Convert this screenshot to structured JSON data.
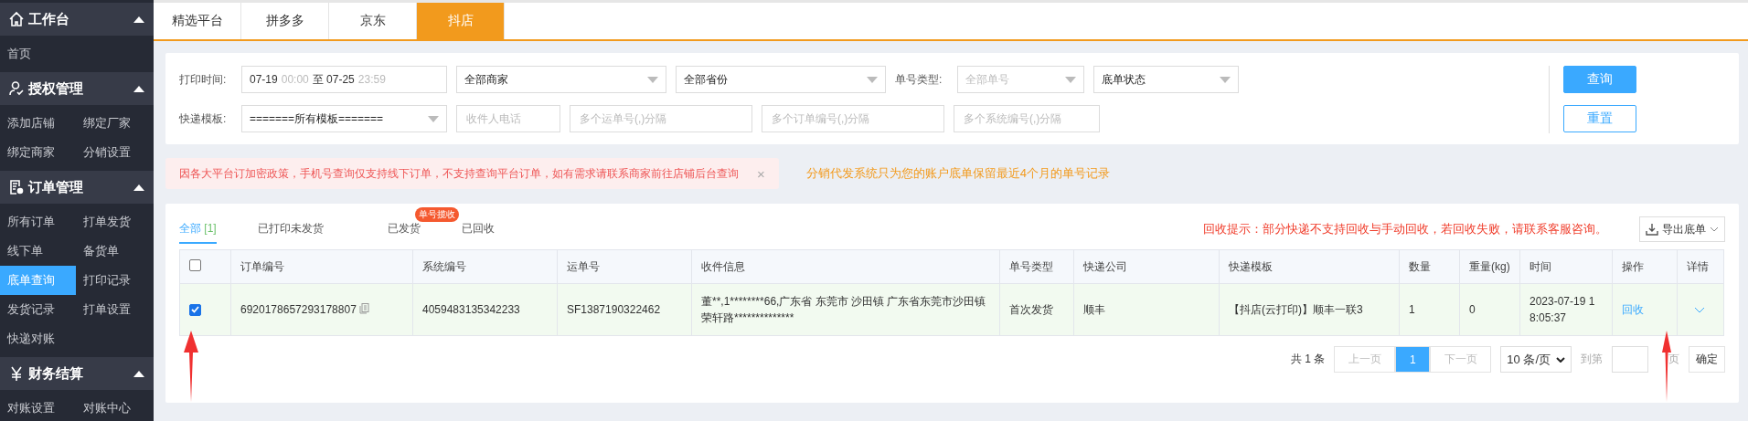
{
  "sidebar": {
    "sections": [
      {
        "title": "工作台",
        "kind": "home",
        "expanded": true,
        "items": [
          {
            "label": "首页",
            "selected": false
          }
        ]
      },
      {
        "title": "授权管理",
        "kind": "user",
        "expanded": true,
        "items": [
          {
            "label": "添加店铺",
            "selected": false
          },
          {
            "label": "绑定厂家",
            "selected": false
          },
          {
            "label": "绑定商家",
            "selected": false
          },
          {
            "label": "分销设置",
            "selected": false
          }
        ]
      },
      {
        "title": "订单管理",
        "kind": "orders",
        "expanded": true,
        "items": [
          {
            "label": "所有订单",
            "selected": false
          },
          {
            "label": "打单发货",
            "selected": false
          },
          {
            "label": "线下单",
            "selected": false
          },
          {
            "label": "备货单",
            "selected": false
          },
          {
            "label": "底单查询",
            "selected": true
          },
          {
            "label": "打印记录",
            "selected": false
          },
          {
            "label": "发货记录",
            "selected": false
          },
          {
            "label": "打单设置",
            "selected": false
          },
          {
            "label": "快递对账",
            "selected": false
          }
        ]
      },
      {
        "title": "财务结算",
        "kind": "finance",
        "expanded": true,
        "items": [
          {
            "label": "对账设置",
            "selected": false
          },
          {
            "label": "对账中心",
            "selected": false
          }
        ]
      }
    ]
  },
  "platform_tabs": [
    {
      "label": "精选平台",
      "selected": false
    },
    {
      "label": "拼多多",
      "selected": false
    },
    {
      "label": "京东",
      "selected": false
    },
    {
      "label": "抖店",
      "selected": true
    }
  ],
  "filters": {
    "print_time": {
      "label": "打印时间:",
      "start_date": "07-19",
      "start_time": "00:00",
      "separator": "至",
      "end_date": "07-25",
      "end_time": "23:59"
    },
    "merchant": {
      "value": "全部商家",
      "disabled": false
    },
    "province": {
      "value": "全部省份",
      "disabled": false
    },
    "number_type_label": "单号类型:",
    "number_type": {
      "value": "全部单号",
      "disabled": true
    },
    "status": {
      "value": "底单状态",
      "disabled": false
    },
    "template_label": "快递模板:",
    "template": {
      "value": "=======所有模板=======",
      "disabled": false
    },
    "phone": {
      "placeholder": "收件人电话"
    },
    "waybills": {
      "placeholder": "多个运单号(,)分隔"
    },
    "orders": {
      "placeholder": "多个订单编号(,)分隔"
    },
    "system_numbers": {
      "placeholder": "多个系统编号(,)分隔"
    },
    "buttons": [
      {
        "label": "查询",
        "kind": "primary"
      },
      {
        "label": "重置",
        "kind": "outline"
      }
    ]
  },
  "notice": {
    "text": "因各大平台订加密政策，手机号查询仅支持线下订单，不支持查询平台订单，如有需求请联系商家前往店铺后台查询",
    "close": "×"
  },
  "info": "分销代发系统只为您的账户底单保留最近4个月的单号记录",
  "record_tabs": [
    {
      "label": "全部",
      "count": "[1]",
      "selected": true
    },
    {
      "label": "已打印未发货",
      "selected": false
    },
    {
      "label": "已发货",
      "badge": "单号揽收",
      "selected": false
    },
    {
      "label": "已回收",
      "selected": false
    }
  ],
  "recycle_tip": "回收提示：部分快递不支持回收与手动回收，若回收失败，请联系客服咨询。",
  "export_button": "导出底单",
  "table": {
    "all_checked": false,
    "columns": [
      "订单编号",
      "系统编号",
      "运单号",
      "收件信息",
      "单号类型",
      "快递公司",
      "快递模板",
      "数量",
      "重量(kg)",
      "时间",
      "操作",
      "详情"
    ],
    "rows": [
      {
        "checked": true,
        "expanded": false,
        "order_no": "6920178657293178807",
        "system_no": "4059483135342233",
        "waybill": "SF1387190322462",
        "recipient": "董**,1********66,广东省 东莞市 沙田镇 广东省东莞市沙田镇荣轩路**************",
        "number_type": "首次发货",
        "courier": "顺丰",
        "template": "【抖店(云打印)】顺丰一联3",
        "quantity": "1",
        "weight": "0",
        "time": "2023-07-19 18:05:37",
        "action": "回收"
      }
    ]
  },
  "pagination": {
    "total": "共 1 条",
    "prev": {
      "label": "上一页",
      "disabled": true
    },
    "pages": [
      {
        "label": "1",
        "selected": true
      }
    ],
    "next": {
      "label": "下一页",
      "disabled": true
    },
    "page_size": "10 条/页",
    "goto_label": "到第",
    "page_unit": "页",
    "confirm": "确定"
  }
}
